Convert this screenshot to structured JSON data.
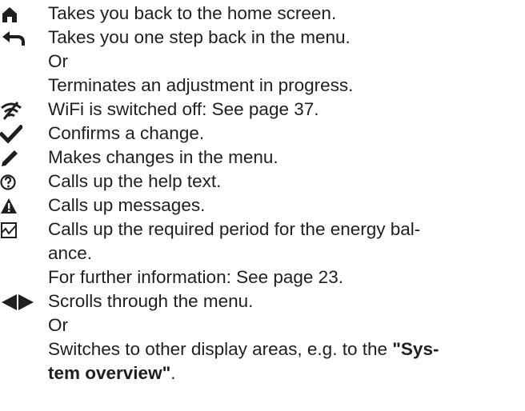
{
  "legend": {
    "home": {
      "icon": "home-icon",
      "text": "Takes you back to the home screen."
    },
    "back": {
      "icon": "back-arrow-icon",
      "line1": "Takes you one step back in the menu.",
      "or": "Or",
      "line2": "Terminates an adjustment in progress."
    },
    "wifi": {
      "icon": "wifi-off-icon",
      "text": "WiFi is switched off: See page 37."
    },
    "confirm": {
      "icon": "checkmark-icon",
      "text": "Confirms a change."
    },
    "edit": {
      "icon": "pencil-icon",
      "text": "Makes changes in the menu."
    },
    "help": {
      "icon": "help-icon",
      "text": "Calls up the help text."
    },
    "messages": {
      "icon": "warning-icon",
      "text": "Calls up messages."
    },
    "energy": {
      "icon": "energy-chart-icon",
      "line1": "Calls up the required period for the energy bal-",
      "line2": "ance.",
      "line3": "For further information: See page 23."
    },
    "scroll": {
      "icon": "scroll-arrows-icon",
      "line1": "Scrolls through the menu.",
      "or": "Or",
      "line2_pre": "Switches to other display areas, e.g. to the ",
      "line2_bold": "\"Sys-",
      "line3_bold": "tem overview\"",
      "line3_post": "."
    }
  }
}
